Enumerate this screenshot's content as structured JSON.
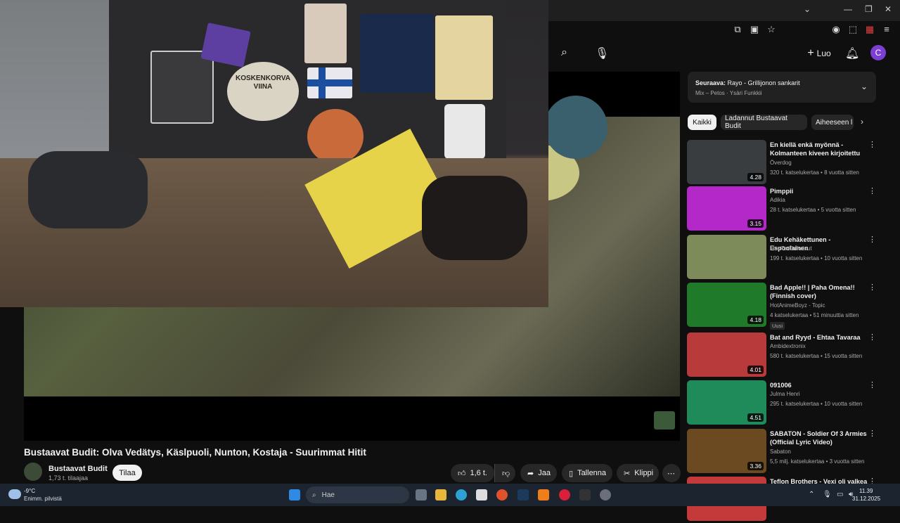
{
  "browser": {
    "window_controls": [
      "⌄",
      "—",
      "❐",
      "✕"
    ]
  },
  "header": {
    "create_label": "Luo",
    "avatar_letter": "C"
  },
  "video": {
    "title": "Bustaavat Budit: Olva Vedätys, Käslpuoli, Nunton, Kostaja - Suurimmat Hitit",
    "channel_name": "Bustaavat Budit",
    "subscribers": "1,73 t. tilaajaa",
    "subscribe_label": "Tilaa",
    "likes": "1,6 t.",
    "share_label": "Jaa",
    "save_label": "Tallenna",
    "clip_label": "Klippi"
  },
  "webcam": {
    "sign_text": "KOSKENKORVA VIINA"
  },
  "next_up": {
    "title_prefix": "Seuraava:",
    "title": "Rayo - Grillijonon sankarit",
    "subtitle": "Mix – Petos · Ysäri Funkkii"
  },
  "chips": [
    "Kaikki",
    "Ladannut Bustaavat Budit",
    "Aiheeseen l"
  ],
  "recommendations": [
    {
      "title": "En kiellä enkä myönnä - Kolmanteen kiveen kirjoitettu",
      "channel": "Överdog",
      "meta": "320 t. katselukertaa • 8 vuotta sitten",
      "duration": "4.28",
      "color": "#3a3d40"
    },
    {
      "title": "Pimppii",
      "channel": "Adikia",
      "meta": "28 t. katselukertaa • 5 vuotta sitten",
      "duration": "3.15",
      "color": "#b427c9"
    },
    {
      "title": "Edu Kehäkettunen - Espoolainen",
      "channel": "FlopTorlJulkaisut",
      "meta": "199 t. katselukertaa • 10 vuotta sitten",
      "duration": "",
      "color": "#7d8a5a"
    },
    {
      "title": "Bad Apple!! | Paha Omena!! (Finnish cover)",
      "channel": "HotAnimeBoyz - Topic",
      "meta": "4 katselukertaa • 51 minuuttia sitten",
      "duration": "4.18",
      "color": "#1f7a2a",
      "badge": "Uusi"
    },
    {
      "title": "Bat and Ryyd - Ehtaa Tavaraa",
      "channel": "Ambidextronix",
      "meta": "580 t. katselukertaa • 15 vuotta sitten",
      "duration": "4.01",
      "color": "#b83a3a"
    },
    {
      "title": "091006",
      "channel": "Julma Henri",
      "meta": "295 t. katselukertaa • 10 vuotta sitten",
      "duration": "4.51",
      "color": "#1f8a5a"
    },
    {
      "title": "SABATON - Soldier Of 3 Armies (Official Lyric Video)",
      "channel": "Sabaton",
      "meta": "5,5 milj. katselukertaa • 3 vuotta sitten",
      "duration": "3.36",
      "color": "#6b4a22"
    },
    {
      "title": "Teflon Brothers - Vexi oli valkea",
      "channel": "",
      "meta": "",
      "duration": "",
      "color": "#c43a3a"
    }
  ],
  "taskbar": {
    "weather_temp": "-9°C",
    "weather_desc": "Enimm. pilvistä",
    "search_placeholder": "Hae",
    "time": "11.39",
    "date": "31.12.2025"
  },
  "colors": {
    "background": "#0f0f0f",
    "chip_active": "#f1f1f1",
    "chip_inactive": "#272727",
    "taskbar": "#1c2430"
  }
}
